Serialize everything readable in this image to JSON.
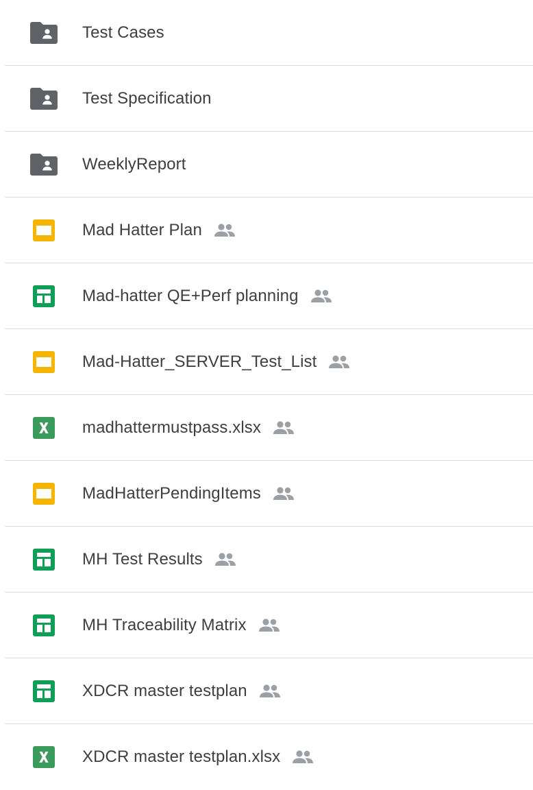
{
  "files": [
    {
      "name": "Test Cases",
      "type": "shared-folder",
      "icon": "shared-folder-icon",
      "shared": false
    },
    {
      "name": "Test Specification",
      "type": "shared-folder",
      "icon": "shared-folder-icon",
      "shared": false
    },
    {
      "name": "WeeklyReport",
      "type": "shared-folder",
      "icon": "shared-folder-icon",
      "shared": false
    },
    {
      "name": "Mad Hatter Plan",
      "type": "slides",
      "icon": "slides-icon",
      "shared": true
    },
    {
      "name": "Mad-hatter QE+Perf planning",
      "type": "sheets",
      "icon": "sheets-icon",
      "shared": true
    },
    {
      "name": "Mad-Hatter_SERVER_Test_List",
      "type": "slides",
      "icon": "slides-icon",
      "shared": true
    },
    {
      "name": "madhattermustpass.xlsx",
      "type": "excel",
      "icon": "excel-icon",
      "shared": true
    },
    {
      "name": "MadHatterPendingItems",
      "type": "slides",
      "icon": "slides-icon",
      "shared": true
    },
    {
      "name": "MH Test Results",
      "type": "sheets",
      "icon": "sheets-icon",
      "shared": true
    },
    {
      "name": "MH Traceability Matrix",
      "type": "sheets",
      "icon": "sheets-icon",
      "shared": true
    },
    {
      "name": "XDCR master testplan",
      "type": "sheets",
      "icon": "sheets-icon",
      "shared": true
    },
    {
      "name": "XDCR master testplan.xlsx",
      "type": "excel",
      "icon": "excel-icon",
      "shared": true
    }
  ],
  "colors": {
    "folder": "#5f6368",
    "slides": "#f4b400",
    "sheets": "#0f9d58",
    "excel": "#3a9b5c",
    "shared_icon": "#9aa0a6",
    "divider": "#dadce0",
    "text": "#3c4043"
  }
}
